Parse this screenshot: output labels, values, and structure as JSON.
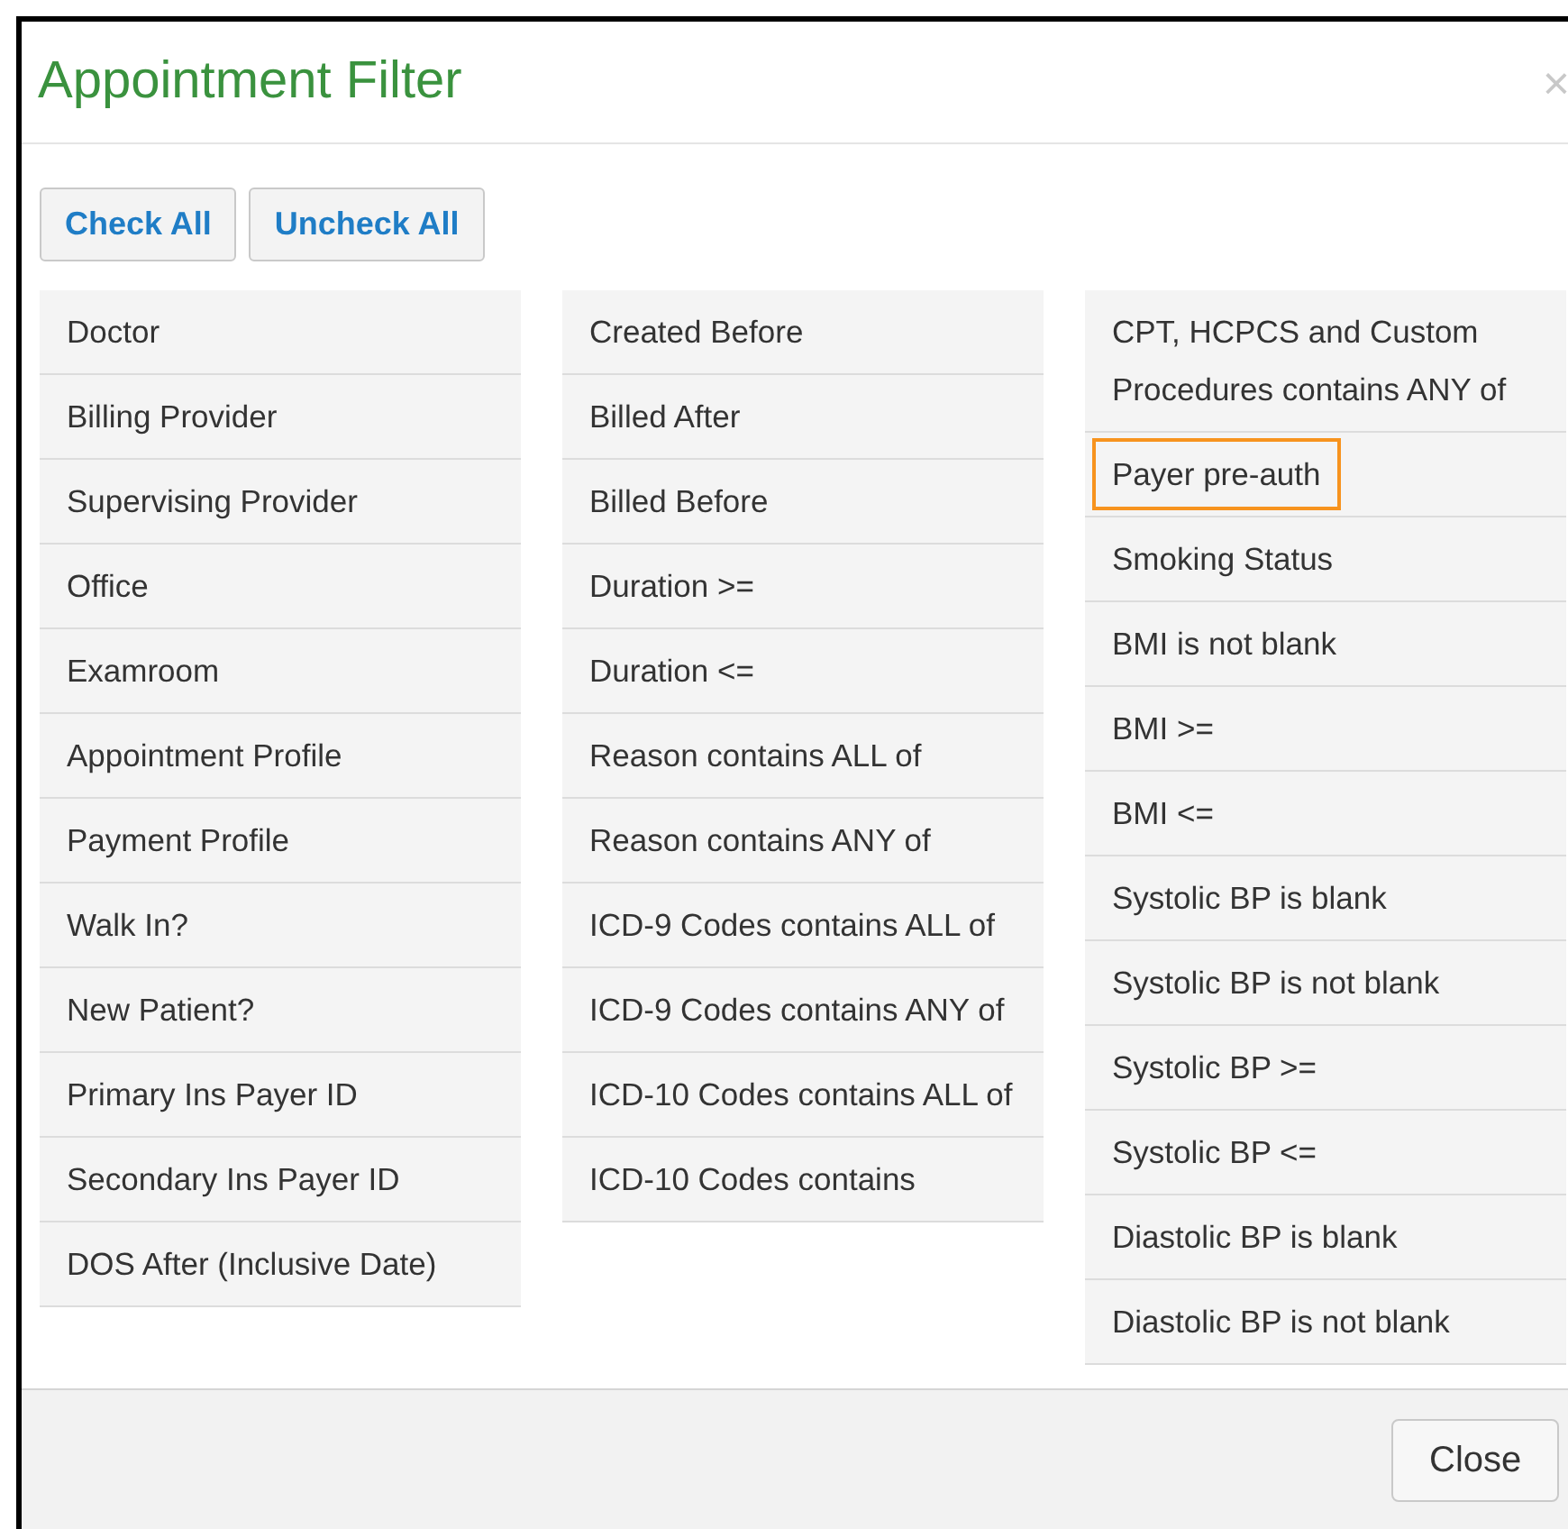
{
  "dialog": {
    "title": "Appointment Filter",
    "close_icon": "×"
  },
  "buttons": [
    "Check All",
    "Uncheck All"
  ],
  "columns": [
    [
      {
        "label": "Doctor",
        "highlighted": false
      },
      {
        "label": "Billing Provider",
        "highlighted": false
      },
      {
        "label": "Supervising Provider",
        "highlighted": false
      },
      {
        "label": "Office",
        "highlighted": false
      },
      {
        "label": "Examroom",
        "highlighted": false
      },
      {
        "label": "Appointment Profile",
        "highlighted": false
      },
      {
        "label": "Payment Profile",
        "highlighted": false
      },
      {
        "label": "Walk In?",
        "highlighted": false
      },
      {
        "label": "New Patient?",
        "highlighted": false
      },
      {
        "label": "Primary Ins Payer ID",
        "highlighted": false
      },
      {
        "label": "Secondary Ins Payer ID",
        "highlighted": false
      },
      {
        "label": "DOS After (Inclusive Date)",
        "highlighted": false
      }
    ],
    [
      {
        "label": "Created Before",
        "highlighted": false
      },
      {
        "label": "Billed After",
        "highlighted": false
      },
      {
        "label": "Billed Before",
        "highlighted": false
      },
      {
        "label": "Duration >=",
        "highlighted": false
      },
      {
        "label": "Duration <=",
        "highlighted": false
      },
      {
        "label": "Reason contains ALL of",
        "highlighted": false
      },
      {
        "label": "Reason contains ANY of",
        "highlighted": false
      },
      {
        "label": "ICD-9 Codes contains ALL of",
        "highlighted": false
      },
      {
        "label": "ICD-9 Codes contains ANY of",
        "highlighted": false
      },
      {
        "label": "ICD-10 Codes contains ALL of",
        "highlighted": false
      },
      {
        "label": "ICD-10 Codes contains",
        "highlighted": false
      }
    ],
    [
      {
        "label": "CPT, HCPCS and Custom Procedures contains ANY of",
        "highlighted": false
      },
      {
        "label": "Payer pre-auth",
        "highlighted": true
      },
      {
        "label": "Smoking Status",
        "highlighted": false
      },
      {
        "label": "BMI is not blank",
        "highlighted": false
      },
      {
        "label": "BMI >=",
        "highlighted": false
      },
      {
        "label": "BMI <=",
        "highlighted": false
      },
      {
        "label": "Systolic BP is blank",
        "highlighted": false
      },
      {
        "label": "Systolic BP is not blank",
        "highlighted": false
      },
      {
        "label": "Systolic BP >=",
        "highlighted": false
      },
      {
        "label": "Systolic BP <=",
        "highlighted": false
      },
      {
        "label": "Diastolic BP is blank",
        "highlighted": false
      },
      {
        "label": "Diastolic BP is not blank",
        "highlighted": false
      }
    ]
  ],
  "footer": {
    "button": "Close"
  }
}
